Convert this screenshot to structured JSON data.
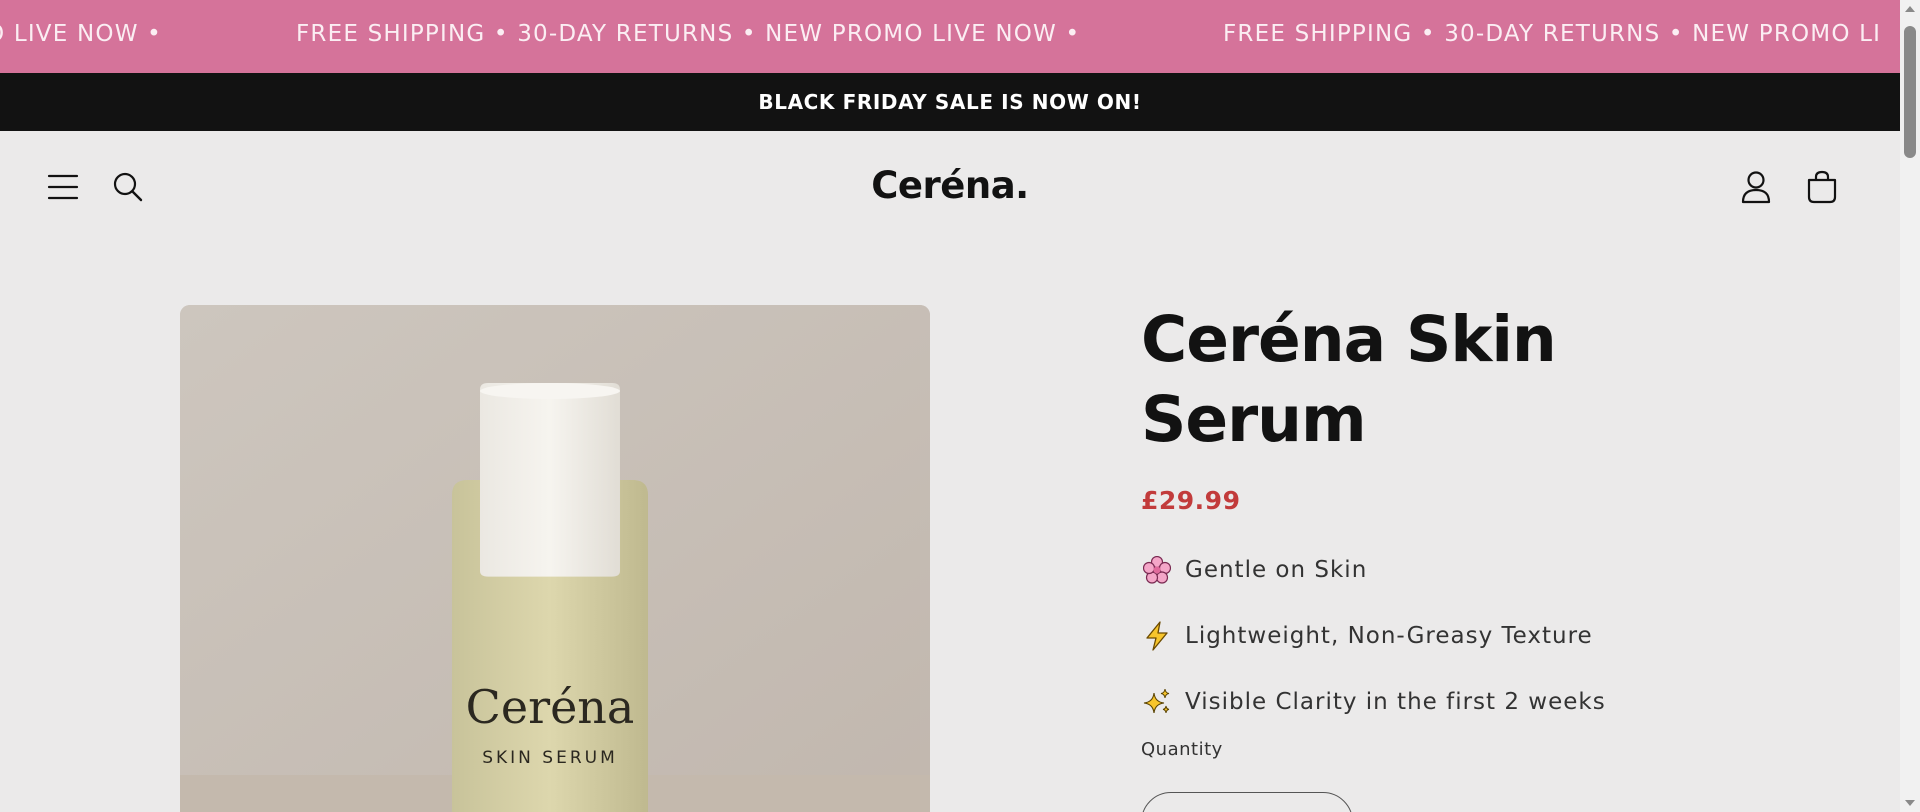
{
  "marquee": {
    "text": "FREE SHIPPING • 30-DAY RETURNS • NEW PROMO LIVE NOW •",
    "partial_left": "O LIVE NOW •",
    "partial_right": "FREE SHIPPING • 30-DAY RETURNS • NEW PROMO LI",
    "background": "#d5739a"
  },
  "announcement": {
    "text": "BLACK FRIDAY SALE IS NOW ON!"
  },
  "header": {
    "logo": "Ceréna.",
    "icons": [
      "menu-icon",
      "search-icon",
      "account-icon",
      "cart-icon"
    ]
  },
  "product": {
    "image_label_brand": "Ceréna",
    "image_label_sub": "SKIN SERUM",
    "title": "Ceréna Skin Serum",
    "price": "£29.99",
    "price_color": "#c23b3b",
    "features": [
      {
        "icon": "cherry-blossom-icon",
        "text": "Gentle on Skin"
      },
      {
        "icon": "lightning-icon",
        "text": "Lightweight, Non-Greasy Texture"
      },
      {
        "icon": "sparkles-icon",
        "text": "Visible Clarity in the first 2 weeks"
      }
    ],
    "quantity_label": "Quantity"
  }
}
